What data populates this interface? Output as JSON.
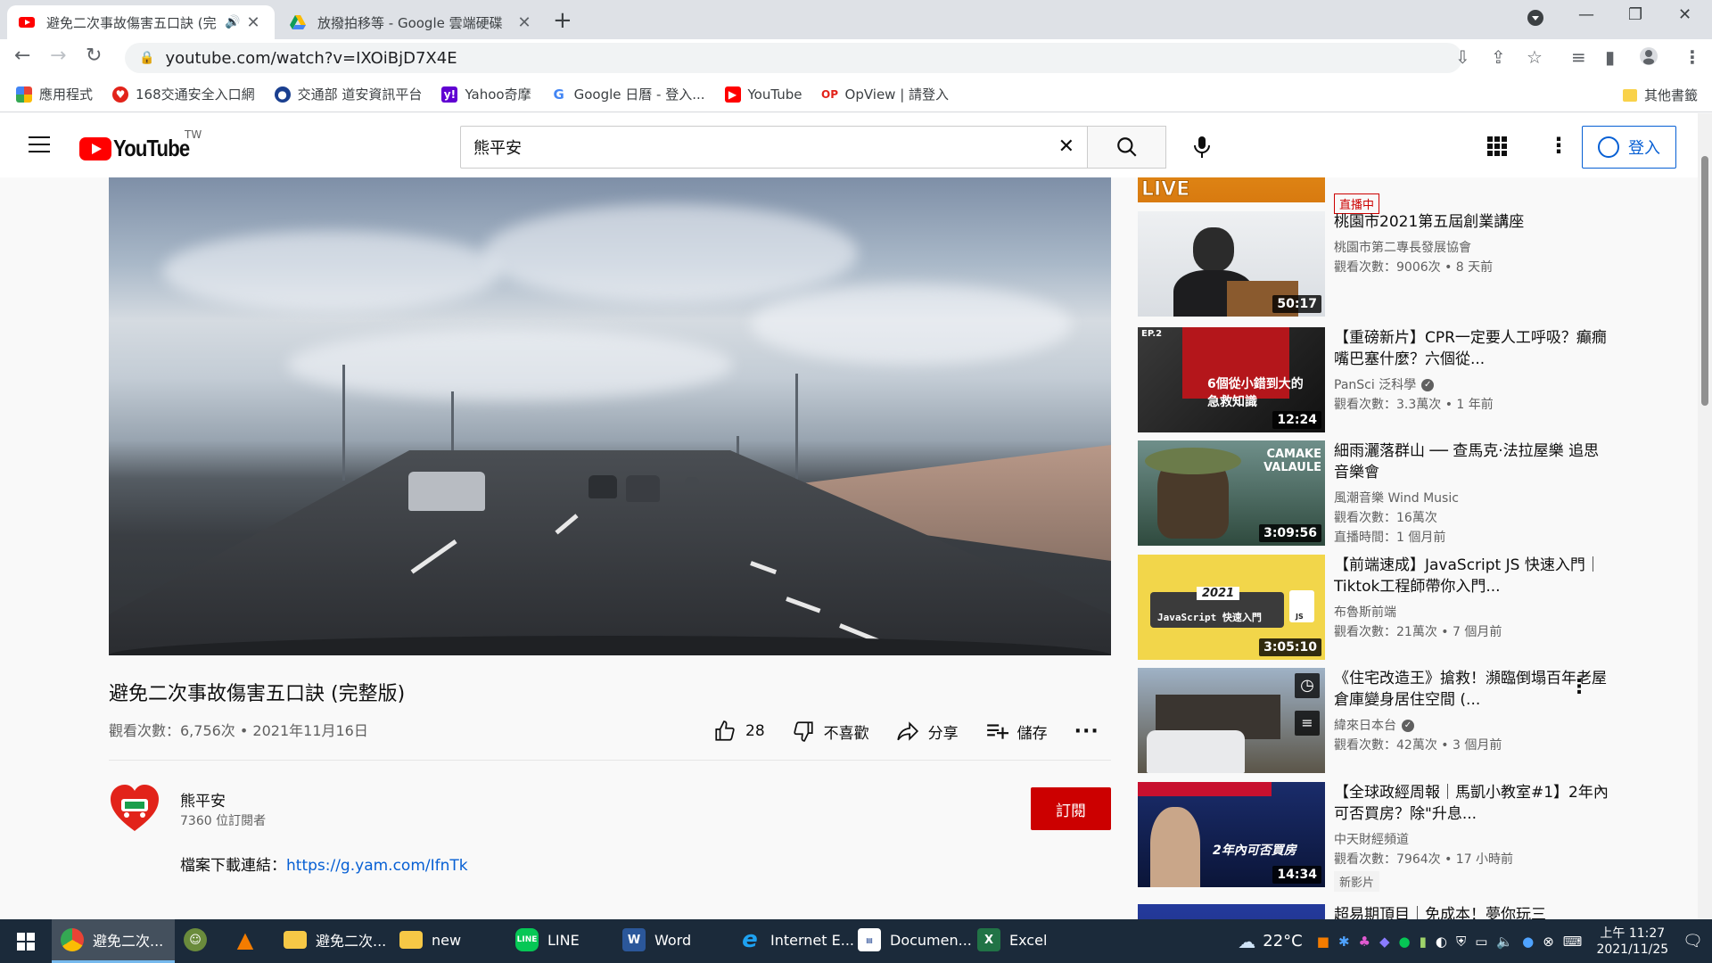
{
  "browser": {
    "tabs": [
      {
        "title": "避免二次事故傷害五口訣 (完",
        "active": true
      },
      {
        "title": "放撥拍移等 - Google 雲端硬碟",
        "active": false
      }
    ],
    "url": "youtube.com/watch?v=IXOiBjD7X4E",
    "bookmarks": [
      "應用程式",
      "168交通安全入口網",
      "交通部 道安資訊平台",
      "Yahoo奇摩",
      "Google 日曆 - 登入...",
      "YouTube",
      "OpView | 請登入"
    ],
    "other_bookmarks": "其他書籤"
  },
  "youtube": {
    "country": "TW",
    "search_value": "熊平安",
    "signin_label": "登入"
  },
  "video": {
    "title": "避免二次事故傷害五口訣 (完整版)",
    "meta": "觀看次數：6,756次 • 2021年11月16日",
    "like_count": "28",
    "dislike_label": "不喜歡",
    "share_label": "分享",
    "save_label": "儲存",
    "channel_name": "熊平安",
    "channel_subs": "7360 位訂閱者",
    "subscribe_label": "訂閱",
    "desc_prefix": "檔案下載連結：",
    "desc_link": "https://g.yam.com/IfnTk"
  },
  "recommendations": [
    {
      "title": "",
      "badge_live": "直播中",
      "thumb_text": "LIVE"
    },
    {
      "title": "桃園市2021第五屆創業講座",
      "channel": "桃園市第二專長發展協會",
      "stats": "觀看次數：9006次 • 8 天前",
      "duration": "50:17"
    },
    {
      "title": "【重磅新片】CPR一定要人工呼吸？癲癇嘴巴塞什麼？六個從...",
      "channel": "PanSci 泛科學",
      "verified": true,
      "stats": "觀看次數：3.3萬次 • 1 年前",
      "duration": "12:24",
      "thumb_text": "6個從小錯到大的急救知識",
      "thumb_ep": "EP.2"
    },
    {
      "title": "細雨灑落群山 ── 查馬克·法拉屋樂 追思音樂會",
      "channel": "風潮音樂 Wind Music",
      "stats": "觀看次數：16萬次",
      "stats2": "直播時間：1 個月前",
      "duration": "3:09:56",
      "thumb_text": "CAMAKE VALAULE"
    },
    {
      "title": "【前端速成】JavaScript JS 快速入門｜Tiktok工程師帶你入門...",
      "channel": "布魯斯前端",
      "stats": "觀看次數：21萬次 • 7 個月前",
      "duration": "3:05:10",
      "thumb_text": "JavaScript 快速入門",
      "thumb_year": "2021",
      "thumb_js": "JS"
    },
    {
      "title": "《住宅改造王》搶救！瀕臨倒塌百年老屋 倉庫變身居住空間 (...",
      "channel": "緯來日本台",
      "verified": true,
      "stats": "觀看次數：42萬次 • 3 個月前"
    },
    {
      "title": "【全球政經周報｜馬凱小教室#1】2年內可否買房？除\"升息...",
      "channel": "中天財經頻道",
      "stats": "觀看次數：7964次 • 17 小時前",
      "badge_new": "新影片",
      "duration": "14:34",
      "thumb_text": "2年內可否買房"
    },
    {
      "title": "超易期頂目｜免成本！夢你玩三"
    }
  ],
  "taskbar": {
    "items": [
      "避免二次...",
      "",
      "",
      "避免二次...",
      "new",
      "LINE",
      "Word",
      "Internet E...",
      "Documen...",
      "Excel"
    ],
    "weather": "22°C",
    "time": "上午 11:27",
    "date": "2021/11/25"
  },
  "colors": {
    "yt_red": "#ff0000",
    "subscribe_red": "#cc0000",
    "link_blue": "#065fd4",
    "taskbar": "#1b2a3a"
  }
}
